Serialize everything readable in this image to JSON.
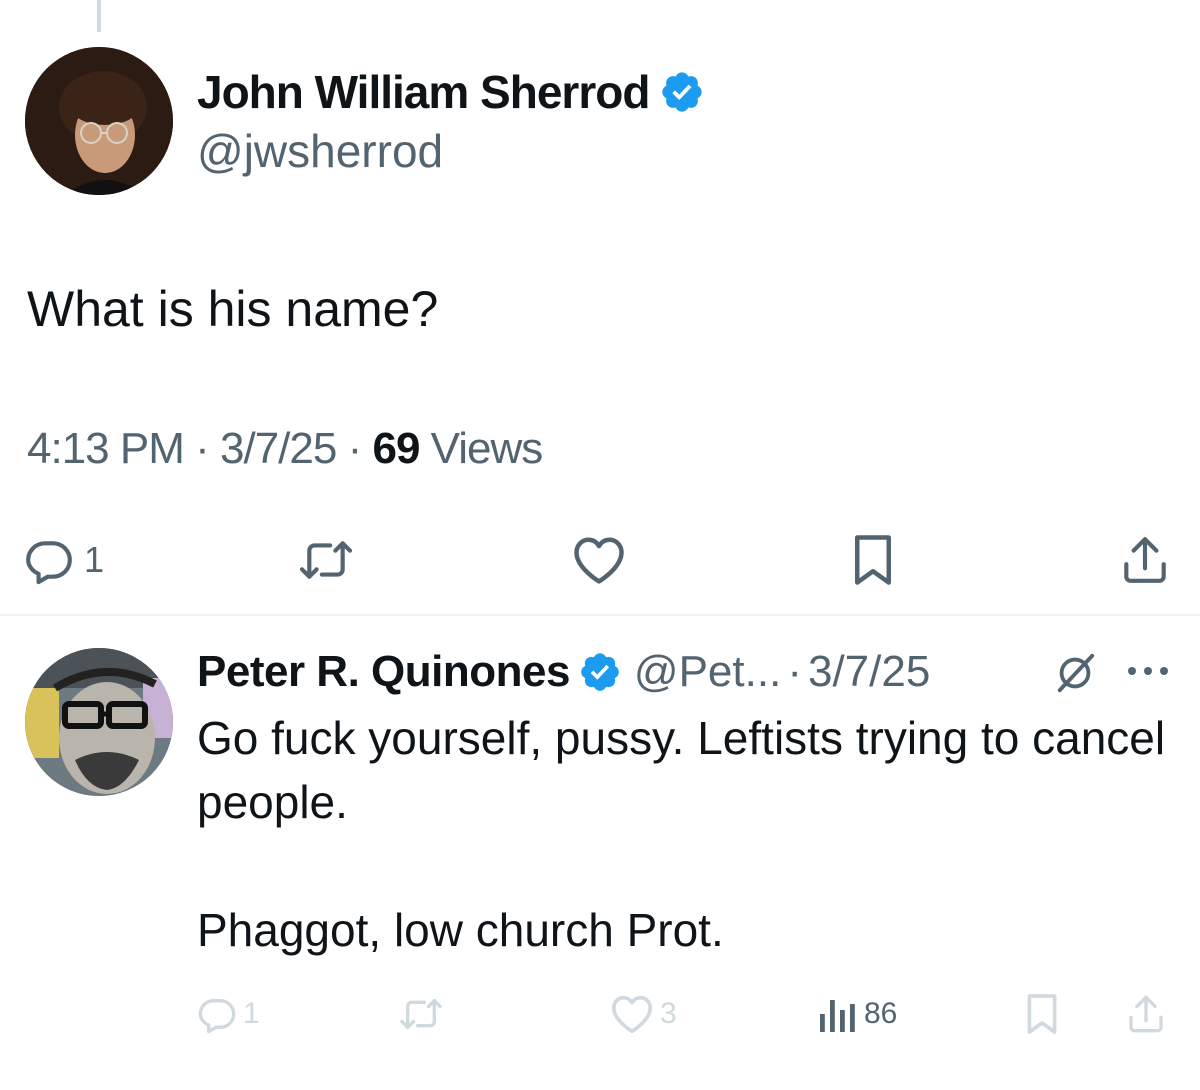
{
  "main_tweet": {
    "author_name": "John William Sherrod",
    "handle": "@jwsherrod",
    "verified": true,
    "text": "What is his name?",
    "time": "4:13 PM",
    "date": "3/7/25",
    "views_count": "69",
    "views_label": "Views",
    "separator": "·",
    "actions": {
      "reply_count": "1",
      "icons": [
        "reply-icon",
        "retweet-icon",
        "like-icon",
        "bookmark-icon",
        "share-icon"
      ]
    }
  },
  "reply_tweet": {
    "author_name": "Peter R. Quinones",
    "handle": "@Pet...",
    "separator": "·",
    "date": "3/7/25",
    "verified": true,
    "text": "Go fuck yourself, pussy. Leftists trying to cancel people.\n\nPhaggot, low church Prot.",
    "actions": {
      "reply_count": "1",
      "like_count": "3",
      "views_count": "86",
      "icons": [
        "reply-icon",
        "retweet-icon",
        "like-icon",
        "views-icon",
        "bookmark-icon",
        "share-icon"
      ]
    }
  },
  "colors": {
    "text_primary": "#0f1419",
    "text_secondary": "#536471",
    "verified_blue": "#1d9bf0",
    "divider": "#eff3f4",
    "faint_icon": "#cfd9de"
  }
}
